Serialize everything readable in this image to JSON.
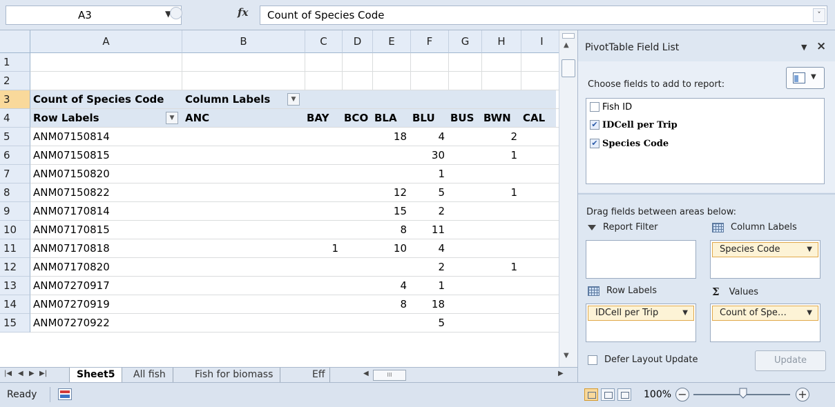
{
  "formula_bar": {
    "name_box": "A3",
    "fx_label": "fx",
    "formula": "Count of Species Code"
  },
  "columns": [
    "A",
    "B",
    "C",
    "D",
    "E",
    "F",
    "G",
    "H",
    "I"
  ],
  "rows": [
    "1",
    "2",
    "3",
    "4",
    "5",
    "6",
    "7",
    "8",
    "9",
    "10",
    "11",
    "12",
    "13",
    "14",
    "15"
  ],
  "pivot": {
    "corner_label": "Count of Species Code",
    "column_labels": "Column Labels",
    "row_labels": "Row Labels",
    "species_headers": [
      "ANC",
      "BAY",
      "BCO",
      "BLA",
      "BLU",
      "BUS",
      "BWN",
      "CAL"
    ],
    "data_rows": [
      {
        "id": "ANM07150814",
        "BAY": "",
        "BLA": "18",
        "BLU": "4",
        "BWN": "2"
      },
      {
        "id": "ANM07150815",
        "BAY": "",
        "BLA": "",
        "BLU": "30",
        "BWN": "1"
      },
      {
        "id": "ANM07150820",
        "BAY": "",
        "BLA": "",
        "BLU": "1",
        "BWN": ""
      },
      {
        "id": "ANM07150822",
        "BAY": "",
        "BLA": "12",
        "BLU": "5",
        "BWN": "1"
      },
      {
        "id": "ANM07170814",
        "BAY": "",
        "BLA": "15",
        "BLU": "2",
        "BWN": ""
      },
      {
        "id": "ANM07170815",
        "BAY": "",
        "BLA": "8",
        "BLU": "11",
        "BWN": ""
      },
      {
        "id": "ANM07170818",
        "BAY": "1",
        "BLA": "10",
        "BLU": "4",
        "BWN": ""
      },
      {
        "id": "ANM07170820",
        "BAY": "",
        "BLA": "",
        "BLU": "2",
        "BWN": "1"
      },
      {
        "id": "ANM07270917",
        "BAY": "",
        "BLA": "4",
        "BLU": "1",
        "BWN": ""
      },
      {
        "id": "ANM07270919",
        "BAY": "",
        "BLA": "8",
        "BLU": "18",
        "BWN": ""
      },
      {
        "id": "ANM07270922",
        "BAY": "",
        "BLA": "",
        "BLU": "5",
        "BWN": ""
      }
    ]
  },
  "sheet_tabs": [
    "Sheet5",
    "All fish",
    "Fish for biomass",
    "Eff"
  ],
  "active_tab": "Sheet5",
  "status": {
    "ready": "Ready",
    "zoom": "100%",
    "zoom_minus": "−",
    "zoom_plus": "+"
  },
  "pivot_pane": {
    "title": "PivotTable Field List",
    "choose_text": "Choose fields to add to report:",
    "fields": [
      {
        "label": "Fish ID",
        "checked": false
      },
      {
        "label": "IDCell per Trip",
        "checked": true
      },
      {
        "label": "Species Code",
        "checked": true
      }
    ],
    "drag_text": "Drag fields between areas below:",
    "areas": {
      "report_filter": {
        "label": "Report Filter",
        "chip": ""
      },
      "column_labels": {
        "label": "Column Labels",
        "chip": "Species Code"
      },
      "row_labels": {
        "label": "Row Labels",
        "chip": "IDCell per Trip"
      },
      "values": {
        "label": "Values",
        "chip": "Count of Spe…"
      }
    },
    "defer_label": "Defer Layout Update",
    "update_button": "Update"
  },
  "colors": {
    "header_band": "#dce6f2",
    "selected_row_header": "#f9d99b",
    "chip_fill": "#fdf3d6"
  }
}
